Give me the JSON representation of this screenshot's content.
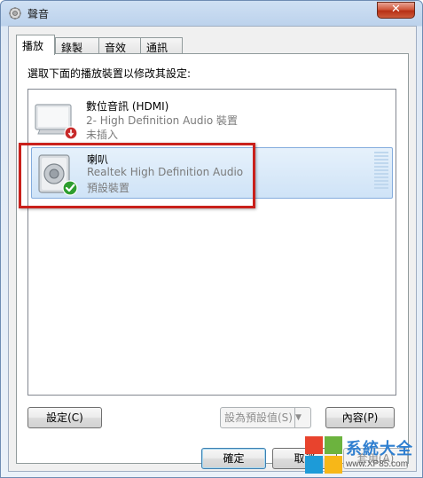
{
  "window": {
    "title": "聲音",
    "close_symbol": "✕"
  },
  "tabs": [
    {
      "label": "播放",
      "active": true
    },
    {
      "label": "錄製",
      "active": false
    },
    {
      "label": "音效",
      "active": false
    },
    {
      "label": "通訊",
      "active": false
    }
  ],
  "instruction": "選取下面的播放裝置以修改其設定:",
  "devices": [
    {
      "name": "數位音訊 (HDMI)",
      "description": "2- High Definition Audio 裝置",
      "status": "未插入",
      "icon": "monitor-icon",
      "badge": "unplugged-badge-icon",
      "selected": false
    },
    {
      "name": "喇叭",
      "description": "Realtek High Definition Audio",
      "status": "預設裝置",
      "icon": "speaker-icon",
      "badge": "default-checkmark-icon",
      "selected": true
    }
  ],
  "buttons": {
    "configure": "設定(C)",
    "set_default": "設為預設值(S)",
    "properties": "內容(P)",
    "ok": "確定",
    "cancel": "取消",
    "apply": "套用(A)"
  },
  "watermark": {
    "brand": "系統大全",
    "url": "www.XP85.com"
  },
  "colors": {
    "highlight_frame": "#c9201b",
    "selection": "#cfe3f7",
    "checkmark": "#2e9e2e"
  }
}
